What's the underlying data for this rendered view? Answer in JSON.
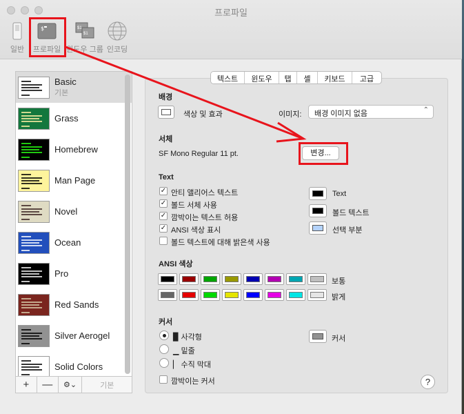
{
  "window": {
    "title": "프로파일"
  },
  "toolbar": {
    "items": [
      "일반",
      "프로파일",
      "윈도우 그룹",
      "인코딩"
    ]
  },
  "profiles": [
    {
      "name": "Basic",
      "sub": "기본",
      "bg": "#ffffff",
      "fg": "#000000"
    },
    {
      "name": "Grass",
      "sub": "",
      "bg": "#13773d",
      "fg": "#fff0a5"
    },
    {
      "name": "Homebrew",
      "sub": "",
      "bg": "#000000",
      "fg": "#28fe14"
    },
    {
      "name": "Man Page",
      "sub": "",
      "bg": "#fef49c",
      "fg": "#000000"
    },
    {
      "name": "Novel",
      "sub": "",
      "bg": "#dfdbc3",
      "fg": "#3b2322"
    },
    {
      "name": "Ocean",
      "sub": "",
      "bg": "#224fbc",
      "fg": "#ffffff"
    },
    {
      "name": "Pro",
      "sub": "",
      "bg": "#000000",
      "fg": "#f2f2f2"
    },
    {
      "name": "Red Sands",
      "sub": "",
      "bg": "#7a251e",
      "fg": "#d7c9a7"
    },
    {
      "name": "Silver Aerogel",
      "sub": "",
      "bg": "#929292",
      "fg": "#000000"
    },
    {
      "name": "Solid Colors",
      "sub": "",
      "bg": "#ffffff",
      "fg": "#000000"
    }
  ],
  "sidebar_bottom": {
    "add": "+",
    "remove": "—",
    "gear": "⚙︎⌄",
    "default": "기본"
  },
  "tabs": [
    "텍스트",
    "윈도우",
    "탭",
    "셸",
    "키보드",
    "고급"
  ],
  "background": {
    "heading": "배경",
    "color_effects": "색상 및 효과",
    "image_label": "이미지:",
    "image_value": "배경 이미지 없음"
  },
  "font": {
    "heading": "서체",
    "value": "SF Mono Regular 11 pt.",
    "change_button": "변경..."
  },
  "text": {
    "heading": "Text",
    "checkboxes": [
      {
        "label": "안티 앨리어스 텍스트",
        "checked": true
      },
      {
        "label": "볼드 서체 사용",
        "checked": true
      },
      {
        "label": "깜박이는 텍스트 허용",
        "checked": true
      },
      {
        "label": "ANSI 색상 표시",
        "checked": true
      },
      {
        "label": "볼드 텍스트에 대해 밝은색 사용",
        "checked": false
      }
    ],
    "color_labels": [
      "Text",
      "볼드 텍스트",
      "선택 부분"
    ],
    "color_values": [
      "#000000",
      "#000000",
      "#b4d3fd"
    ]
  },
  "ansi": {
    "heading": "ANSI 색상",
    "normal_label": "보통",
    "bright_label": "밝게",
    "normal": [
      "#000000",
      "#990000",
      "#00a600",
      "#999900",
      "#0000b2",
      "#b200b2",
      "#00a6b2",
      "#bfbfbf"
    ],
    "bright": [
      "#666666",
      "#e50000",
      "#00d900",
      "#e5e500",
      "#0000ff",
      "#e500e5",
      "#00e5e5",
      "#e5e5e5"
    ]
  },
  "cursor": {
    "heading": "커서",
    "options": [
      "▉ 사각형",
      "▁ 밑줄",
      "▏ 수직 막대"
    ],
    "selected": 0,
    "blink_label": "깜박이는 커서",
    "color_label": "커서",
    "color": "#929292"
  },
  "help": "?"
}
